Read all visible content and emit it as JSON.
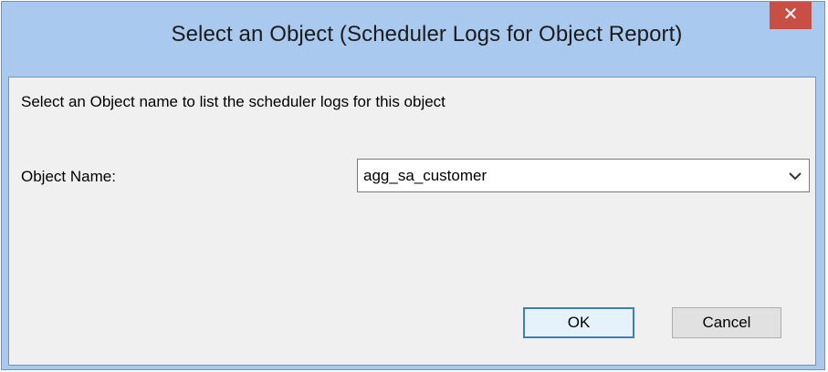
{
  "window": {
    "title": "Select an Object (Scheduler Logs for Object Report)",
    "close_glyph": "✕"
  },
  "form": {
    "instruction": "Select an Object name to list the scheduler logs for this object",
    "object_name_label": "Object Name:",
    "object_name_value": "agg_sa_customer"
  },
  "buttons": {
    "ok_label": "OK",
    "cancel_label": "Cancel"
  },
  "colors": {
    "frame": "#a9c9ee",
    "close_button": "#c74f45",
    "client_bg": "#f0f0f0"
  },
  "icons": {
    "close": "close-icon",
    "dropdown": "chevron-down-icon"
  }
}
